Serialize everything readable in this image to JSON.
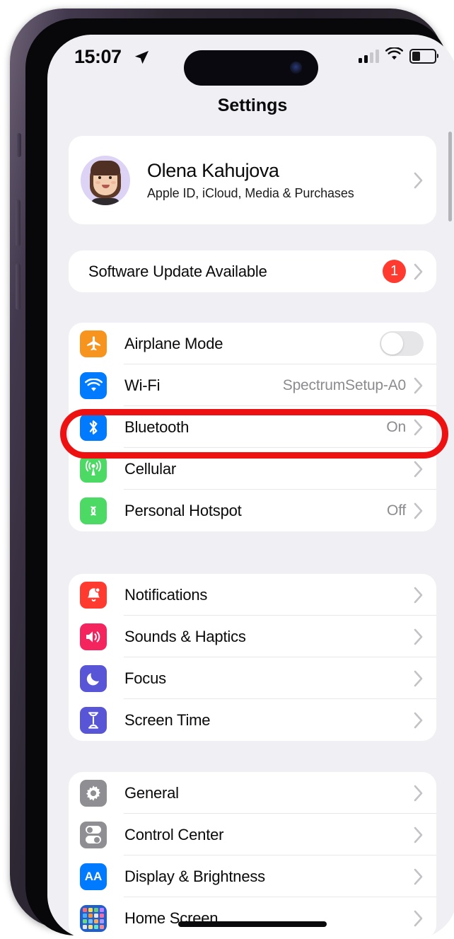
{
  "status_bar": {
    "time": "15:07",
    "location_icon": "location-arrow-icon",
    "cellular_icon": "cellular-signal-icon",
    "cellular_bars_on": 2,
    "wifi_icon": "wifi-icon",
    "battery_icon": "battery-icon",
    "battery_level_pct": 42
  },
  "nav": {
    "title": "Settings"
  },
  "profile": {
    "name": "Olena Kahujova",
    "subtitle": "Apple ID, iCloud, Media & Purchases",
    "avatar_name": "memoji-avatar",
    "avatar_bg": "#DCD3F5"
  },
  "update": {
    "label": "Software Update Available",
    "badge": "1",
    "badge_color": "#FF3B30"
  },
  "groups": [
    {
      "id": "connectivity",
      "rows": [
        {
          "label": "Airplane Mode",
          "value": "",
          "icon": "airplane-icon",
          "icon_color": "#F7941E",
          "control": "toggle",
          "toggle_on": false
        },
        {
          "label": "Wi-Fi",
          "value": "SpectrumSetup-A0",
          "icon": "wifi-icon",
          "icon_color": "#007AFF",
          "control": "chevron"
        },
        {
          "label": "Bluetooth",
          "value": "On",
          "icon": "bluetooth-icon",
          "icon_color": "#007AFF",
          "control": "chevron"
        },
        {
          "label": "Cellular",
          "value": "",
          "icon": "cellular-antenna-icon",
          "icon_color": "#4CD964",
          "control": "chevron"
        },
        {
          "label": "Personal Hotspot",
          "value": "Off",
          "icon": "hotspot-icon",
          "icon_color": "#4CD964",
          "control": "chevron"
        }
      ]
    },
    {
      "id": "notifications",
      "rows": [
        {
          "label": "Notifications",
          "value": "",
          "icon": "bell-icon",
          "icon_color": "#FF3B30",
          "control": "chevron"
        },
        {
          "label": "Sounds & Haptics",
          "value": "",
          "icon": "speaker-icon",
          "icon_color": "#F4245E",
          "control": "chevron"
        },
        {
          "label": "Focus",
          "value": "",
          "icon": "moon-icon",
          "icon_color": "#5856D6",
          "control": "chevron"
        },
        {
          "label": "Screen Time",
          "value": "",
          "icon": "hourglass-icon",
          "icon_color": "#5856D6",
          "control": "chevron"
        }
      ]
    },
    {
      "id": "general",
      "rows": [
        {
          "label": "General",
          "value": "",
          "icon": "gear-icon",
          "icon_color": "#8E8E93",
          "control": "chevron"
        },
        {
          "label": "Control Center",
          "value": "",
          "icon": "control-center-icon",
          "icon_color": "#8E8E93",
          "control": "chevron"
        },
        {
          "label": "Display & Brightness",
          "value": "",
          "icon": "display-brightness-icon",
          "icon_color": "#007AFF",
          "control": "chevron"
        },
        {
          "label": "Home Screen",
          "value": "",
          "icon": "home-screen-grid-icon",
          "icon_color": "#1D5FD0",
          "control": "chevron"
        }
      ]
    }
  ],
  "annotation": {
    "name": "bluetooth-highlight-ellipse",
    "color": "#EE1111",
    "targets_row": "Bluetooth"
  },
  "display_brightness_glyph": "AA"
}
